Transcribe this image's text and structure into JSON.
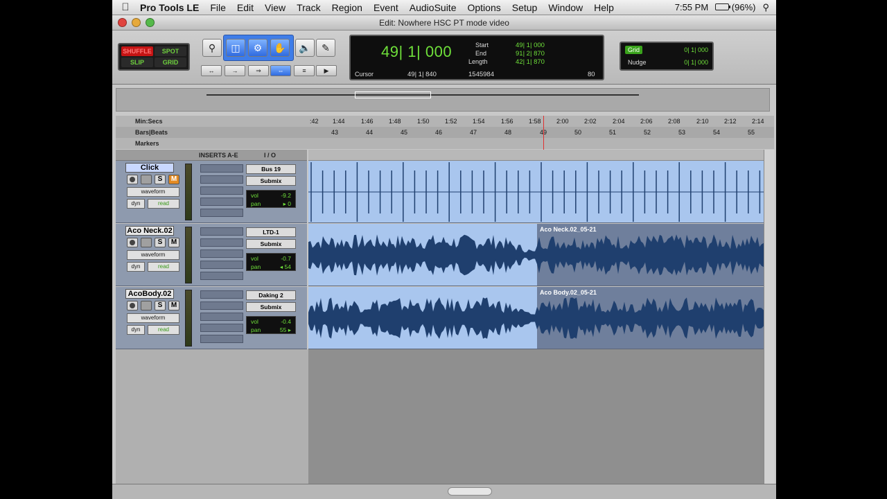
{
  "menubar": {
    "app": "Pro Tools LE",
    "items": [
      "File",
      "Edit",
      "View",
      "Track",
      "Region",
      "Event",
      "AudioSuite",
      "Options",
      "Setup",
      "Window",
      "Help"
    ],
    "clock": "7:55 PM",
    "battery": "(96%)"
  },
  "window": {
    "title": "Edit: Nowhere HSC PT mode video"
  },
  "modes": {
    "shuffle": "SHUFFLE",
    "spot": "SPOT",
    "slip": "SLIP",
    "grid": "GRID"
  },
  "counter": {
    "main": "49| 1| 000",
    "start_label": "Start",
    "start": "49| 1| 000",
    "end_label": "End",
    "end": "91| 2| 870",
    "length_label": "Length",
    "length": "42| 1| 870",
    "cursor_label": "Cursor",
    "cursor": "49| 1| 840",
    "samples": "1545984",
    "tempo": "80"
  },
  "grid": {
    "grid_label": "Grid",
    "grid_value": "0| 1| 000",
    "nudge_label": "Nudge",
    "nudge_value": "0| 1| 000"
  },
  "rulers": {
    "minsecs_label": "Min:Secs",
    "minsecs_ticks": [
      ":42",
      "1:44",
      "1:46",
      "1:48",
      "1:50",
      "1:52",
      "1:54",
      "1:56",
      "1:58",
      "2:00",
      "2:02",
      "2:04",
      "2:06",
      "2:08",
      "2:10",
      "2:12",
      "2:14"
    ],
    "barsbeats_label": "Bars|Beats",
    "bars_ticks": [
      "43",
      "44",
      "45",
      "46",
      "47",
      "48",
      "49",
      "50",
      "51",
      "52",
      "53",
      "54",
      "55"
    ],
    "markers_label": "Markers"
  },
  "columns": {
    "inserts": "INSERTS A-E",
    "io": "I / O"
  },
  "tracks": [
    {
      "name": "Click",
      "view": "waveform",
      "dyn": "dyn",
      "auto": "read",
      "output": "Bus 19",
      "bus": "Submix",
      "vol": "-9.2",
      "pan": "▸ 0",
      "clip": ""
    },
    {
      "name": "Aco Neck.02",
      "view": "waveform",
      "dyn": "dyn",
      "auto": "read",
      "output": "LTD-1",
      "bus": "Submix",
      "vol": "-0.7",
      "pan": "◂ 54",
      "clip": "Aco Neck.02_05-21"
    },
    {
      "name": "AcoBody.02",
      "view": "waveform",
      "dyn": "dyn",
      "auto": "read",
      "output": "Daking 2",
      "bus": "Submix",
      "vol": "-0.4",
      "pan": "55 ▸",
      "clip": "Aco Body.02_05-21"
    }
  ],
  "labels": {
    "vol": "vol",
    "pan": "pan",
    "solo": "S",
    "mute": "M"
  },
  "colors": {
    "lane": "#a9c6ee",
    "selected_clip": "#6f7f9c",
    "counter_green": "#6fe03a",
    "mute_on": "#e38a22"
  },
  "icons": [
    "apple-icon",
    "zoom-icon",
    "trim-icon",
    "selector-icon",
    "grabber-icon",
    "scrub-icon",
    "pencil-icon",
    "speaker-icon",
    "battery-icon",
    "search-icon"
  ]
}
